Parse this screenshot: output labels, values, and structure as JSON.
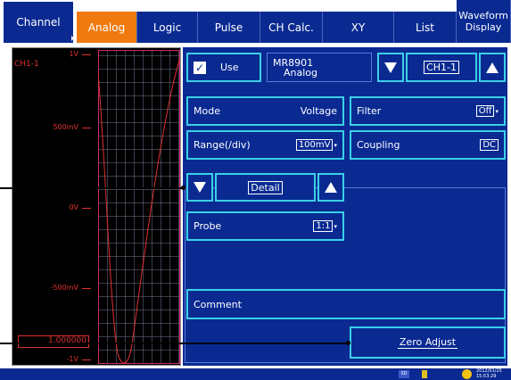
{
  "tabs": {
    "channel": "Channel",
    "analog": "Analog",
    "logic": "Logic",
    "pulse": "Pulse",
    "ch_calc": "CH Calc.",
    "xy": "XY",
    "list": "List",
    "waveform_1": "Waveform",
    "waveform_2": "Display"
  },
  "waveform": {
    "channel_label": "CH1-1",
    "y_labels": [
      "1V",
      "500mV",
      "0V",
      "-500mV",
      "-1V"
    ],
    "value_box": "1.000000"
  },
  "panel": {
    "use_check": "✓",
    "use_label": "Use",
    "module_line1": "MR8901",
    "module_line2": "Analog",
    "channel_select": "CH1-1",
    "mode_label": "Mode",
    "mode_value": "Voltage",
    "filter_label": "Filter",
    "filter_value": "Off",
    "range_label": "Range(/div)",
    "range_value": "100mV",
    "coupling_label": "Coupling",
    "coupling_value": "DC",
    "detail_label": "Detail",
    "probe_label": "Probe",
    "probe_value": "1:1",
    "comment_label": "Comment",
    "zero_adjust_label": "Zero Adjust"
  },
  "status": {
    "sd": "SD",
    "date": "2012/01/25",
    "time": "15:53:29"
  },
  "colors": {
    "panel_blue": "#0a2a92",
    "active_tab": "#f07a10",
    "accent_cyan": "#3ad0e8",
    "wave_red": "#e03030"
  }
}
